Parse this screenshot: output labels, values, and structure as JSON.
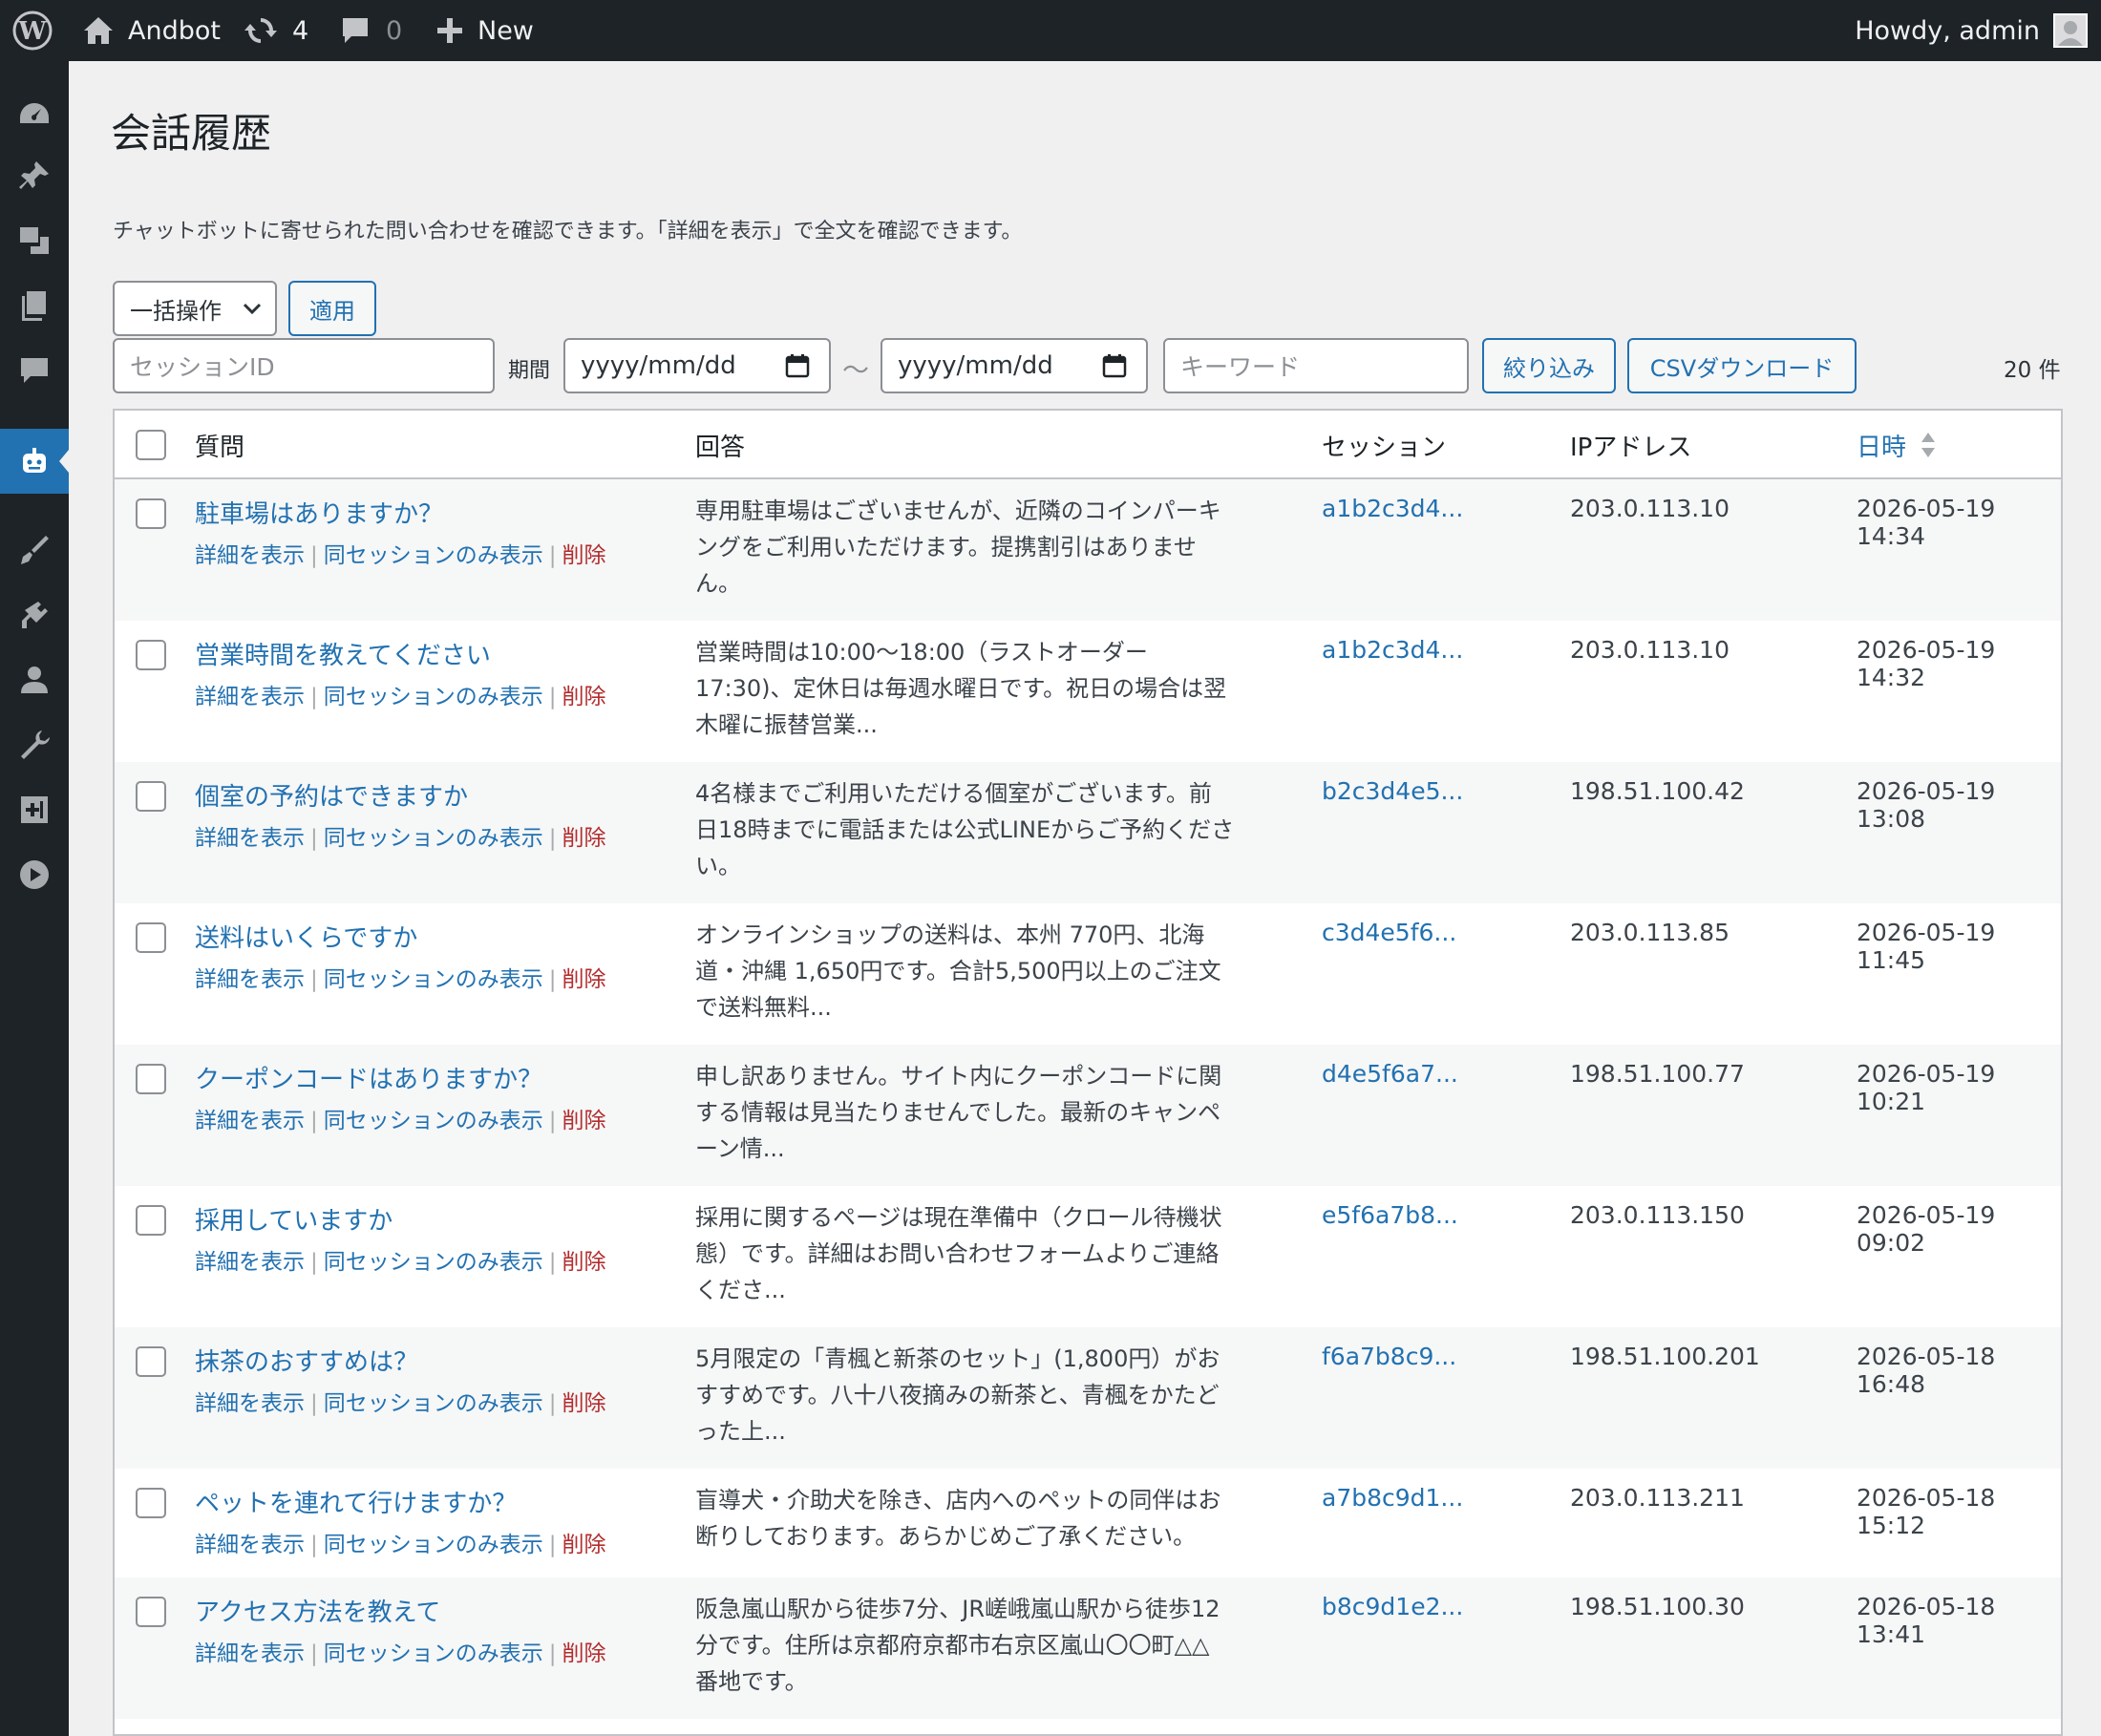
{
  "adminbar": {
    "site_name": "Andbot",
    "updates_count": "4",
    "comments_count": "0",
    "new_label": "New",
    "howdy": "Howdy, admin"
  },
  "page": {
    "title": "会話履歴",
    "description": "チャットボットに寄せられた問い合わせを確認できます。「詳細を表示」で全文を確認できます。"
  },
  "toolbar": {
    "bulk_action": "一括操作",
    "apply": "適用",
    "session_placeholder": "セッションID",
    "period_label": "期間",
    "date_from": "yyyy/mm/dd",
    "tilde": "〜",
    "date_to": "yyyy/mm/dd",
    "keyword_placeholder": "キーワード",
    "filter": "絞り込み",
    "csv": "CSVダウンロード",
    "count": "20 件"
  },
  "table": {
    "headers": {
      "question": "質問",
      "answer": "回答",
      "session": "セッション",
      "ip": "IPアドレス",
      "datetime": "日時"
    },
    "action_labels": {
      "detail": "詳細を表示",
      "same_session": "同セッションのみ表示",
      "delete": "削除"
    },
    "rows": [
      {
        "question": "駐車場はありますか？",
        "answer": [
          "専用駐車場はございませんが、近隣のコインパーキ",
          "ングをご利用いただけます。提携割引はありませ",
          "ん。"
        ],
        "session": "a1b2c3d4...",
        "ip": "203.0.113.10",
        "datetime": "2026-05-19 14:34"
      },
      {
        "question": "営業時間を教えてください",
        "answer": [
          "営業時間は10:00〜18:00（ラストオーダー",
          "17:30)、定休日は毎週水曜日です。祝日の場合は翌",
          "木曜に振替営業..."
        ],
        "session": "a1b2c3d4...",
        "ip": "203.0.113.10",
        "datetime": "2026-05-19 14:32"
      },
      {
        "question": "個室の予約はできますか",
        "answer": [
          "4名様までご利用いただける個室がございます。前",
          "日18時までに電話または公式LINEからご予約くださ",
          "い。"
        ],
        "session": "b2c3d4e5...",
        "ip": "198.51.100.42",
        "datetime": "2026-05-19 13:08"
      },
      {
        "question": "送料はいくらですか",
        "answer": [
          "オンラインショップの送料は、本州 770円、北海",
          "道・沖縄 1,650円です。合計5,500円以上のご注文",
          "で送料無料..."
        ],
        "session": "c3d4e5f6...",
        "ip": "203.0.113.85",
        "datetime": "2026-05-19 11:45"
      },
      {
        "question": "クーポンコードはありますか？",
        "answer": [
          "申し訳ありません。サイト内にクーポンコードに関",
          "する情報は見当たりませんでした。最新のキャンペ",
          "ーン情..."
        ],
        "session": "d4e5f6a7...",
        "ip": "198.51.100.77",
        "datetime": "2026-05-19 10:21"
      },
      {
        "question": "採用していますか",
        "answer": [
          "採用に関するページは現在準備中（クロール待機状",
          "態）です。詳細はお問い合わせフォームよりご連絡",
          "くださ..."
        ],
        "session": "e5f6a7b8...",
        "ip": "203.0.113.150",
        "datetime": "2026-05-19 09:02"
      },
      {
        "question": "抹茶のおすすめは？",
        "answer": [
          "5月限定の「青楓と新茶のセット」(1,800円）がお",
          "すすめです。八十八夜摘みの新茶と、青楓をかたど",
          "った上..."
        ],
        "session": "f6a7b8c9...",
        "ip": "198.51.100.201",
        "datetime": "2026-05-18 16:48"
      },
      {
        "question": "ペットを連れて行けますか？",
        "answer": [
          "盲導犬・介助犬を除き、店内へのペットの同伴はお",
          "断りしております。あらかじめご了承ください。"
        ],
        "session": "a7b8c9d1...",
        "ip": "203.0.113.211",
        "datetime": "2026-05-18 15:12"
      },
      {
        "question": "アクセス方法を教えて",
        "answer": [
          "阪急嵐山駅から徒歩7分、JR嵯峨嵐山駅から徒歩12",
          "分です。住所は京都府京都市右京区嵐山〇〇町△△",
          "番地です。"
        ],
        "session": "b8c9d1e2...",
        "ip": "198.51.100.30",
        "datetime": "2026-05-18 13:41"
      }
    ]
  },
  "colors": {
    "adminbar_bg": "#1d2327",
    "accent": "#2271b1",
    "delete": "#b32d2e",
    "page_bg": "#f0f0f1"
  }
}
